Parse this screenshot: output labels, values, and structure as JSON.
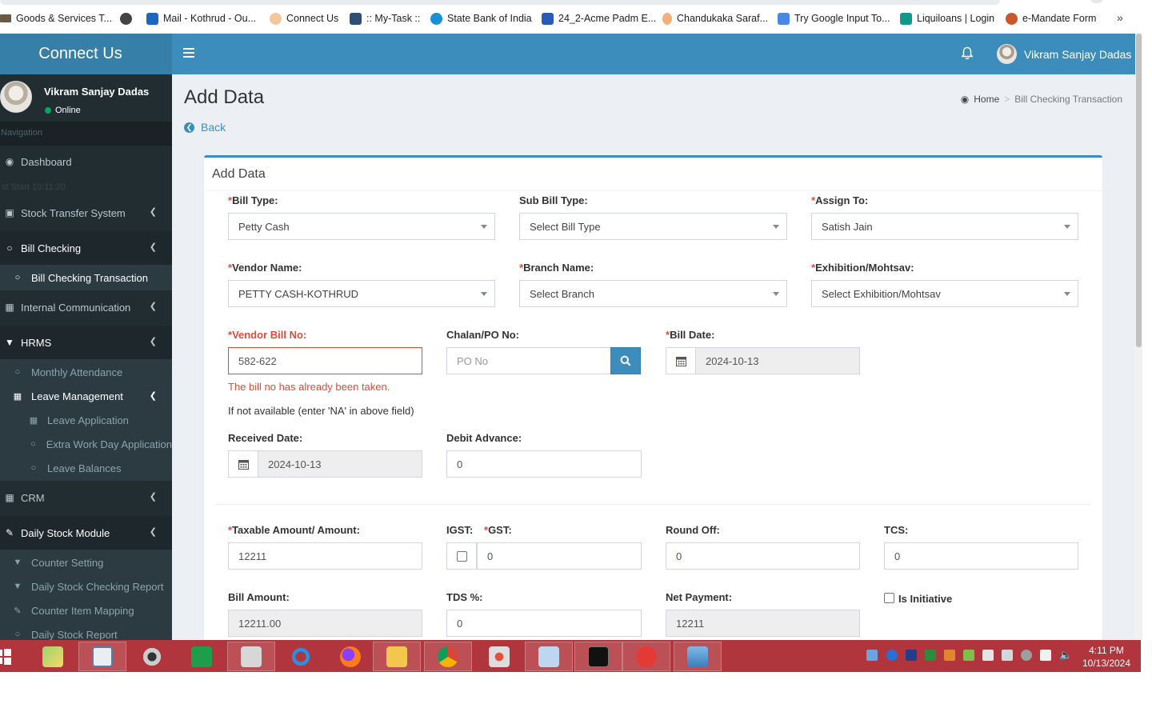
{
  "bookmarks": [
    {
      "label": "Goods & Services T...",
      "icon": "gst-icon",
      "color": "#6d5a45"
    },
    {
      "label": "Mail - Kothrud - Ou...",
      "icon": "outlook-icon",
      "color": "#1a66c4"
    },
    {
      "label": "Connect Us",
      "icon": "connect-us-icon",
      "color": "#e08a3c"
    },
    {
      "label": ":: My-Task ::",
      "icon": "mytask-icon",
      "color": "#2d4f73"
    },
    {
      "label": "State Bank of India",
      "icon": "sbi-icon",
      "color": "#1b8fd6"
    },
    {
      "label": "24_2-Acme Padm E...",
      "icon": "acme-icon",
      "color": "#2a5bb8"
    },
    {
      "label": "Chandukaka Saraf...",
      "icon": "chandukaka-icon",
      "color": "#d9782d"
    },
    {
      "label": "Try Google Input To...",
      "icon": "google-input-icon",
      "color": "#4a86e8"
    },
    {
      "label": "Liquiloans | Login",
      "icon": "liquiloans-icon",
      "color": "#0d9a8c"
    },
    {
      "label": "e-Mandate Form",
      "icon": "emandate-icon",
      "color": "#c9592c"
    }
  ],
  "bookmarks_more": "»",
  "sidebar": {
    "logo": "Connect Us",
    "user_name": "Vikram Sanjay Dadas",
    "user_status": "Online",
    "nav_header": "Navigation",
    "faded_text": "st Start 10:11:20",
    "items": {
      "dashboard": "Dashboard",
      "stock_transfer": "Stock Transfer System",
      "bill_checking": "Bill Checking",
      "bill_checking_transaction": "Bill Checking Transaction",
      "internal_communication": "Internal Communication",
      "hrms": "HRMS",
      "monthly_attendance": "Monthly Attendance",
      "leave_management": "Leave Management",
      "leave_application": "Leave Application",
      "extra_work_day": "Extra Work Day Application",
      "leave_balances": "Leave Balances",
      "crm": "CRM",
      "daily_stock_module": "Daily Stock Module",
      "counter_setting": "Counter Setting",
      "daily_stock_checking_report": "Daily Stock Checking Report",
      "counter_item_mapping": "Counter Item Mapping",
      "daily_stock_report": "Daily Stock Report"
    }
  },
  "topbar": {
    "user_name": "Vikram Sanjay Dadas"
  },
  "page": {
    "title": "Add Data",
    "breadcrumb_home": "Home",
    "breadcrumb_sep": ">",
    "breadcrumb_current": "Bill Checking Transaction",
    "back": "Back"
  },
  "form": {
    "box_title": "Add Data",
    "required_mark": "*",
    "bill_type": {
      "label": "Bill Type:",
      "value": "Petty Cash"
    },
    "sub_bill_type": {
      "label": "Sub Bill Type:",
      "value": "Select Bill Type"
    },
    "assign_to": {
      "label": "Assign To:",
      "value": "Satish Jain"
    },
    "vendor_name": {
      "label": "Vendor Name:",
      "value": "PETTY CASH-KOTHRUD"
    },
    "branch_name": {
      "label": "Branch Name:",
      "value": "Select Branch"
    },
    "exhibition": {
      "label": "Exhibition/Mohtsav:",
      "value": "Select Exhibition/Mohtsav"
    },
    "vendor_bill_no": {
      "label": "Vendor Bill No:",
      "value": "582-622",
      "error": "The bill no has already been taken.",
      "help": "If not available (enter 'NA' in above field)"
    },
    "chalan_po_no": {
      "label": "Chalan/PO No:",
      "placeholder": "PO No"
    },
    "bill_date": {
      "label": "Bill Date:",
      "value": "2024-10-13"
    },
    "received_date": {
      "label": "Received Date:",
      "value": "2024-10-13"
    },
    "debit_advance": {
      "label": "Debit Advance:",
      "value": "0"
    },
    "taxable_amount": {
      "label": "Taxable Amount/ Amount:",
      "value": "12211"
    },
    "igst": {
      "label": "IGST:",
      "checked": false
    },
    "gst": {
      "label": "GST:",
      "value": "0"
    },
    "round_off": {
      "label": "Round Off:",
      "value": "0"
    },
    "tcs": {
      "label": "TCS:",
      "value": "0"
    },
    "bill_amount": {
      "label": "Bill Amount:",
      "value": "12211.00"
    },
    "tds_percent": {
      "label": "TDS %:",
      "value": "0"
    },
    "net_payment": {
      "label": "Net Payment:",
      "value": "12211"
    },
    "is_initiative": {
      "label": "Is Initiative",
      "checked": false
    }
  },
  "taskbar": {
    "apps": [
      "windows-start-icon",
      "sticky-notes-icon",
      "word-pad-icon",
      "webcam-icon",
      "excel-icon",
      "printer-icon",
      "internet-explorer-icon",
      "firefox-icon",
      "file-explorer-icon",
      "chrome-icon",
      "snipping-tool-icon",
      "calculator-icon",
      "command-prompt-icon",
      "vs-app-icon",
      "photo-viewer-icon"
    ],
    "time": "4:11 PM",
    "date": "10/13/2024"
  },
  "colors": {
    "topbar": "#3c8dbc",
    "logo_bg": "#367fa9",
    "sidebar": "#222d32",
    "error": "#dd4b39",
    "taskbar": "#b0353c"
  }
}
